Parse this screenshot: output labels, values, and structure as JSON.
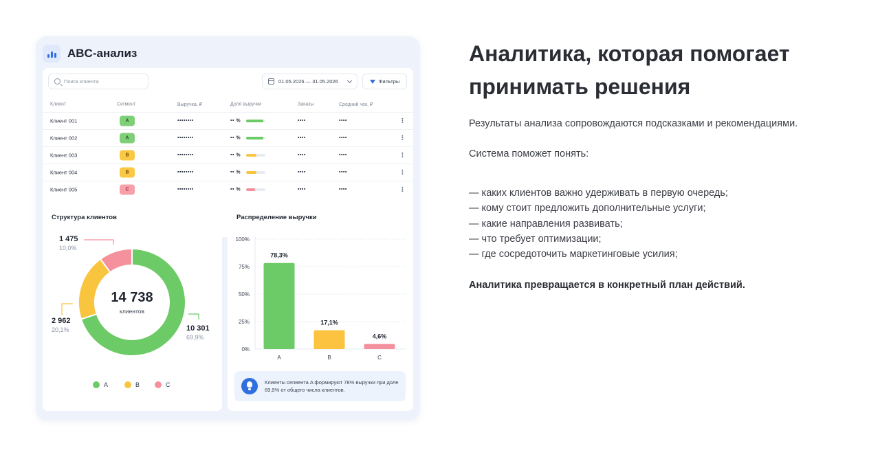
{
  "dashboard": {
    "title": "ABC-анализ",
    "search_placeholder": "Поиск клиента",
    "date_range": "01.05.2026 — 31.05.2026",
    "filter_label": "Фильтры",
    "table": {
      "headers": [
        "Клиент",
        "Сегмент",
        "Выручка, ₽",
        "Доля выручки",
        "Заказы",
        "Средний чек, ₽"
      ],
      "rows": [
        {
          "client": "Клиент 001",
          "segment": "A",
          "revenue": "••••••••",
          "share": "•• %",
          "share_fill": 0.9,
          "orders": "••••",
          "avg": "••••"
        },
        {
          "client": "Клиент 002",
          "segment": "A",
          "revenue": "••••••••",
          "share": "•• %",
          "share_fill": 0.9,
          "orders": "••••",
          "avg": "••••"
        },
        {
          "client": "Клиент 003",
          "segment": "B",
          "revenue": "••••••••",
          "share": "•• %",
          "share_fill": 0.55,
          "orders": "••••",
          "avg": "••••"
        },
        {
          "client": "Клиент 004",
          "segment": "B",
          "revenue": "••••••••",
          "share": "•• %",
          "share_fill": 0.55,
          "orders": "••••",
          "avg": "••••"
        },
        {
          "client": "Клиент 005",
          "segment": "C",
          "revenue": "••••••••",
          "share": "•• %",
          "share_fill": 0.45,
          "orders": "••••",
          "avg": "••••"
        }
      ]
    },
    "structure": {
      "title": "Структура клиентов",
      "total": "14 738",
      "total_label": "клиентов",
      "segments": [
        {
          "name": "A",
          "count": "10 301",
          "pct": "69,9%",
          "value": 69.9,
          "color": "#6ccb66"
        },
        {
          "name": "B",
          "count": "2 962",
          "pct": "20,1%",
          "value": 20.1,
          "color": "#f9c53f"
        },
        {
          "name": "C",
          "count": "1 475",
          "pct": "10,0%",
          "value": 10.0,
          "color": "#f4919c"
        }
      ]
    },
    "revenue": {
      "title": "Распределение выручки",
      "tip": "Клиенты сегмента A формируют 78% выручки при доле 69,9% от общего числа клиентов."
    }
  },
  "chart_data": [
    {
      "type": "pie",
      "title": "Структура клиентов",
      "categories": [
        "A",
        "B",
        "C"
      ],
      "values": [
        10301,
        2962,
        1475
      ],
      "percent_labels": [
        "69,9%",
        "20,1%",
        "10,0%"
      ],
      "center_text": "14 738 клиентов",
      "legend": "bottom"
    },
    {
      "type": "bar",
      "title": "Распределение выручки",
      "categories": [
        "A",
        "B",
        "C"
      ],
      "values": [
        78.3,
        17.1,
        4.6
      ],
      "value_labels": [
        "78,3%",
        "17,1%",
        "4,6%"
      ],
      "y_ticks": [
        "0%",
        "25%",
        "50%",
        "75%",
        "100%"
      ],
      "ylim": [
        0,
        100
      ],
      "grid": true,
      "colors": [
        "#6ccb66",
        "#fbc33f",
        "#f4919c"
      ]
    }
  ],
  "article": {
    "headline": "Аналитика, которая помогает принимать решения",
    "intro": "Результаты анализа сопровождаются подсказками и рекомендациями.",
    "lead": "Система поможет понять:",
    "bullets": [
      "— каких клиентов важно удерживать в первую очередь;",
      "— кому стоит предложить дополнительные услуги;",
      "— какие направления развивать;",
      "— что требует оптимизации;",
      "— где сосредоточить маркетинговые усилия;"
    ],
    "conclusion": "Аналитика превращается в конкретный план действий."
  }
}
